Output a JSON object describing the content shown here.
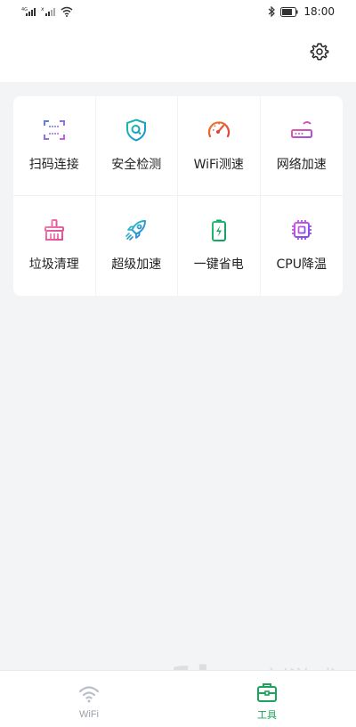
{
  "status_bar": {
    "time": "18:00",
    "signal_icons": [
      "signal-4g-icon",
      "signal-icon",
      "wifi-icon"
    ],
    "battery_icon": "battery-icon",
    "bluetooth_icon": "bluetooth-icon"
  },
  "header": {
    "settings_icon": "gear-icon"
  },
  "tools": [
    {
      "label": "扫码连接",
      "icon": "scan-icon",
      "color": "#7b5cf0"
    },
    {
      "label": "安全检测",
      "icon": "shield-search-icon",
      "color": "#1fb5a5"
    },
    {
      "label": "WiFi测速",
      "icon": "speedometer-icon",
      "color": "#e9572f"
    },
    {
      "label": "网络加速",
      "icon": "router-icon",
      "color": "#d94fbf"
    },
    {
      "label": "垃圾清理",
      "icon": "broom-icon",
      "color": "#e85fb0"
    },
    {
      "label": "超级加速",
      "icon": "rocket-icon",
      "color": "#22a6c9"
    },
    {
      "label": "一键省电",
      "icon": "battery-charge-icon",
      "color": "#1aa55a"
    },
    {
      "label": "CPU降温",
      "icon": "cpu-icon",
      "color": "#b24fe0"
    }
  ],
  "bottom_nav": {
    "items": [
      {
        "label": "WiFi",
        "icon": "wifi-icon",
        "active": false
      },
      {
        "label": "工具",
        "icon": "toolbox-icon",
        "active": true
      }
    ]
  },
  "watermark": {
    "brand": "1kx",
    "text": "一刻游戏网",
    "url": "www.1kyx.com"
  }
}
